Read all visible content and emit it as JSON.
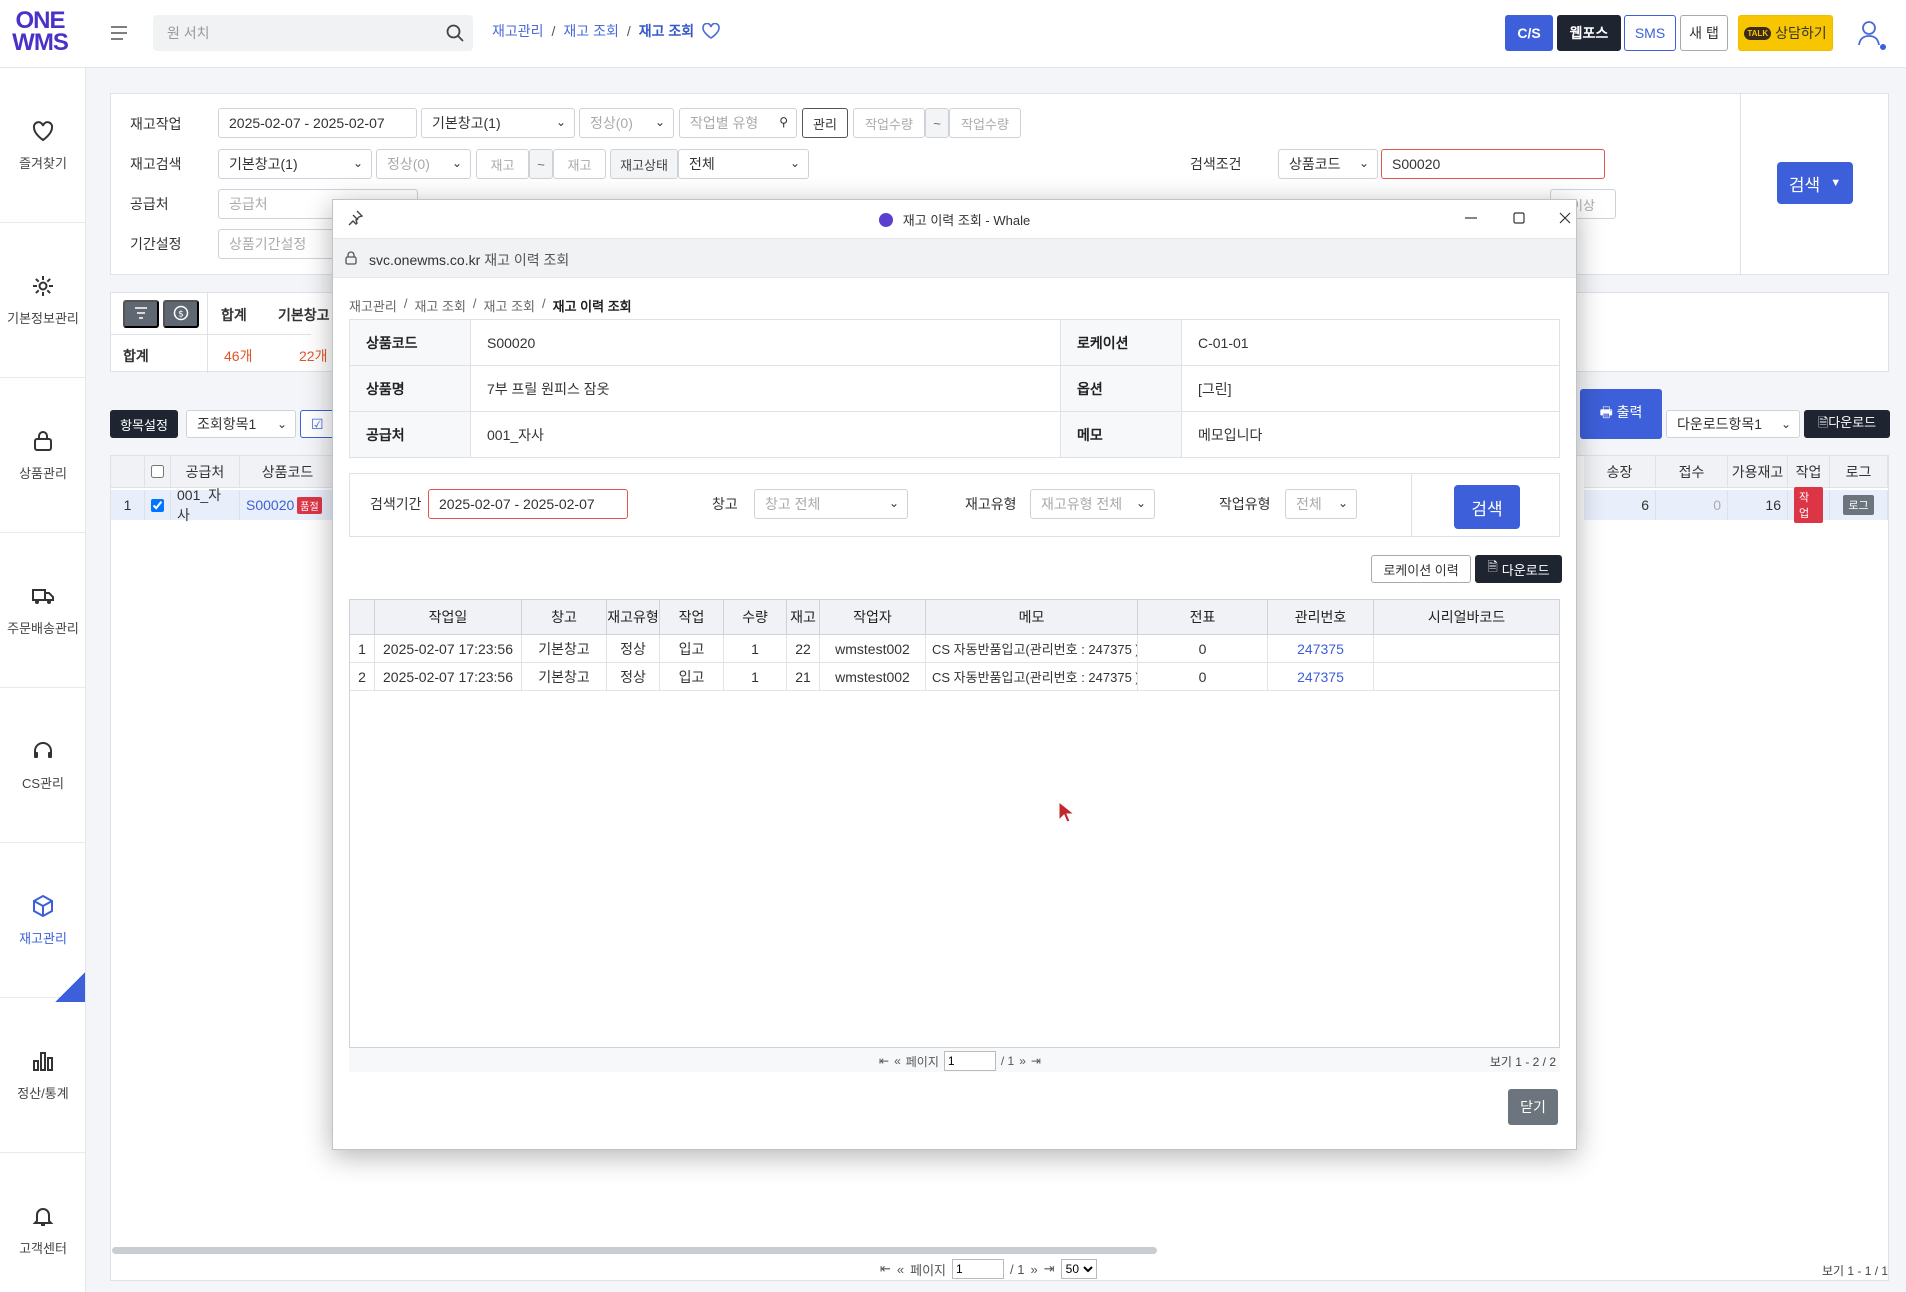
{
  "app": {
    "logo_line1": "ONE",
    "logo_line2": "WMS",
    "search_placeholder": "원 서치",
    "breadcrumb": [
      "재고관리",
      "재고 조회",
      "재고 조회"
    ],
    "buttons": {
      "cs": "C/S",
      "webpos": "웹포스",
      "sms": "SMS",
      "newtab": "새 탭",
      "talk": "상담하기",
      "talk_badge": "TALK"
    }
  },
  "sidebar": {
    "items": [
      {
        "label": "즐겨찾기",
        "icon": "heart-icon"
      },
      {
        "label": "기본정보관리",
        "icon": "gear-icon"
      },
      {
        "label": "상품관리",
        "icon": "lock-icon"
      },
      {
        "label": "주문배송관리",
        "icon": "truck-icon"
      },
      {
        "label": "CS관리",
        "icon": "headset-icon"
      },
      {
        "label": "재고관리",
        "icon": "box-icon"
      },
      {
        "label": "정산/통계",
        "icon": "bar-chart-icon"
      },
      {
        "label": "고객센터",
        "icon": "bell-icon"
      }
    ],
    "active": "재고관리"
  },
  "search_panel": {
    "row1": {
      "label": "재고작업",
      "date_range": "2025-02-07 - 2025-02-07",
      "warehouse": "기본창고(1)",
      "status": "정상(0)",
      "work_type_placeholder": "작업별 유형",
      "manage_btn": "관리",
      "qty_from": "작업수량",
      "tilde": "~",
      "qty_to": "작업수량"
    },
    "row2": {
      "label": "재고검색",
      "warehouse": "기본창고(1)",
      "status": "정상(0)",
      "stock_from": "재고",
      "tilde": "~",
      "stock_to": "재고",
      "stock_status_label": "재고상태",
      "stock_status": "전체",
      "cond_label": "검색조건",
      "cond_select": "상품코드",
      "cond_value": "S00020"
    },
    "row3": {
      "label": "공급처",
      "supplier_placeholder": "공급처",
      "more_label": "이상"
    },
    "row4": {
      "label": "기간설정",
      "period_placeholder": "상품기간설정"
    },
    "search_btn": "검색"
  },
  "summary": {
    "col_total": "합계",
    "col_basic": "기본창고",
    "row_label": "합계",
    "total": "46개",
    "basic": "22개"
  },
  "list": {
    "item_setting": "항목설정",
    "view_item": "조회항목1",
    "print": "출력",
    "download_item": "다운로드항목1",
    "download": "다운로드",
    "headers": [
      "공급처",
      "상품코드",
      "송장",
      "접수",
      "가용재고",
      "작업",
      "로그"
    ],
    "row": {
      "no": "1",
      "supplier": "001_자사",
      "code": "S00020",
      "badge": "품절",
      "invoice": "6",
      "accept": "0",
      "available": "16",
      "work": "작업",
      "log": "로그"
    },
    "pager": {
      "page_label": "페이지",
      "page": "1",
      "of": "/ 1",
      "per_page": "50",
      "count": "보기 1 - 1 / 1"
    }
  },
  "popup": {
    "title": "재고 이력 조회 - Whale",
    "url_host": "svc.onewms.co.kr",
    "url_title": "재고 이력 조회",
    "breadcrumb": [
      "재고관리",
      "재고 조회",
      "재고 조회",
      "재고 이력 조회"
    ],
    "info": {
      "code_label": "상품코드",
      "code": "S00020",
      "location_label": "로케이션",
      "location": "C-01-01",
      "name_label": "상품명",
      "name": "7부 프릴 원피스 잠옷",
      "option_label": "옵션",
      "option": "[그린]",
      "supplier_label": "공급처",
      "supplier": "001_자사",
      "memo_label": "메모",
      "memo": "메모입니다"
    },
    "filters": {
      "period_label": "검색기간",
      "period": "2025-02-07 - 2025-02-07",
      "warehouse_label": "창고",
      "warehouse": "창고 전체",
      "stock_type_label": "재고유형",
      "stock_type": "재고유형 전체",
      "work_type_label": "작업유형",
      "work_type": "전체",
      "search_btn": "검색"
    },
    "location_history_btn": "로케이션 이력",
    "download_btn": "다운로드",
    "grid": {
      "headers": [
        "작업일",
        "창고",
        "재고유형",
        "작업",
        "수량",
        "재고",
        "작업자",
        "메모",
        "전표",
        "관리번호",
        "시리얼바코드"
      ],
      "rows": [
        [
          "1",
          "2025-02-07 17:23:56",
          "기본창고",
          "정상",
          "입고",
          "1",
          "22",
          "wmstest002",
          "CS 자동반품입고(관리번호 : 247375 )",
          "0",
          "247375",
          ""
        ],
        [
          "2",
          "2025-02-07 17:23:56",
          "기본창고",
          "정상",
          "입고",
          "1",
          "21",
          "wmstest002",
          "CS 자동반품입고(관리번호 : 247375 )",
          "0",
          "247375",
          ""
        ]
      ],
      "pager": {
        "page_label": "페이지",
        "page": "1",
        "of": "/ 1",
        "count": "보기 1 - 2 / 2"
      }
    },
    "close_btn": "닫기"
  }
}
